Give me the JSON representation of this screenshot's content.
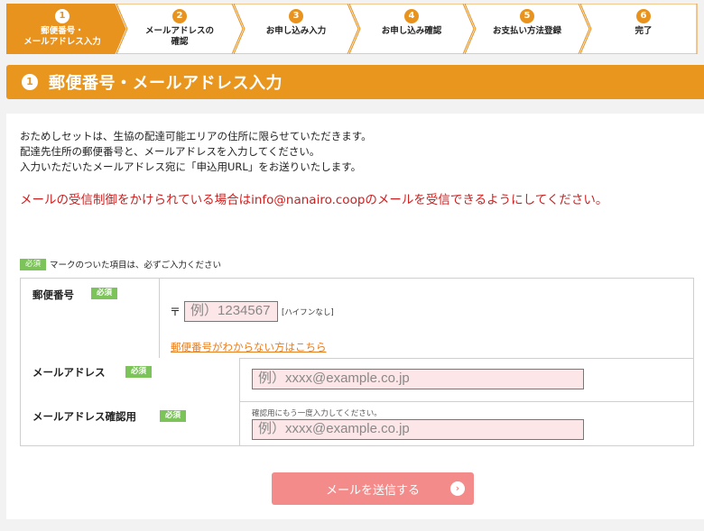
{
  "steps": [
    {
      "num": "1",
      "label_line1": "郵便番号・",
      "label_line2": "メールアドレス入力",
      "active": true
    },
    {
      "num": "2",
      "label_line1": "メールアドレスの",
      "label_line2": "確認",
      "active": false
    },
    {
      "num": "3",
      "label_line1": "お申し込み入力",
      "label_line2": "",
      "active": false
    },
    {
      "num": "4",
      "label_line1": "お申し込み確認",
      "label_line2": "",
      "active": false
    },
    {
      "num": "5",
      "label_line1": "お支払い方法登録",
      "label_line2": "",
      "active": false
    },
    {
      "num": "6",
      "label_line1": "完了",
      "label_line2": "",
      "active": false
    }
  ],
  "section": {
    "num": "1",
    "title": "郵便番号・メールアドレス入力"
  },
  "intro": {
    "line1": "おためしセットは、生協の配達可能エリアの住所に限らせていただきます。",
    "line2": "配達先住所の郵便番号と、メールアドレスを入力してください。",
    "line3": "入力いただいたメールアドレス宛に「申込用URL」をお送りいたします。"
  },
  "warning": "メールの受信制御をかけられている場合はinfo@nanairo.coopのメールを受信できるようにしてください。",
  "legend": {
    "badge": "必須",
    "text": "マークのついた項目は、必ずご入力ください"
  },
  "form": {
    "required_badge": "必須",
    "zip": {
      "label": "郵便番号",
      "mark": "〒",
      "placeholder": "例）1234567",
      "hint": "[ハイフンなし]",
      "link": "郵便番号がわからない方はこちら"
    },
    "email": {
      "label": "メールアドレス",
      "placeholder": "例）xxxx@example.co.jp"
    },
    "email_confirm": {
      "label": "メールアドレス確認用",
      "note": "確認用にもう一度入力してください。",
      "placeholder": "例）xxxx@example.co.jp"
    }
  },
  "submit": {
    "label": "メールを送信する",
    "icon": "chevron-right-icon"
  },
  "colors": {
    "accent": "#e9961f",
    "required": "#7cc35a",
    "warning": "#cc1f1f",
    "submit": "#f48b8b",
    "link": "#e67e22",
    "input_bg": "#fde6e8"
  }
}
